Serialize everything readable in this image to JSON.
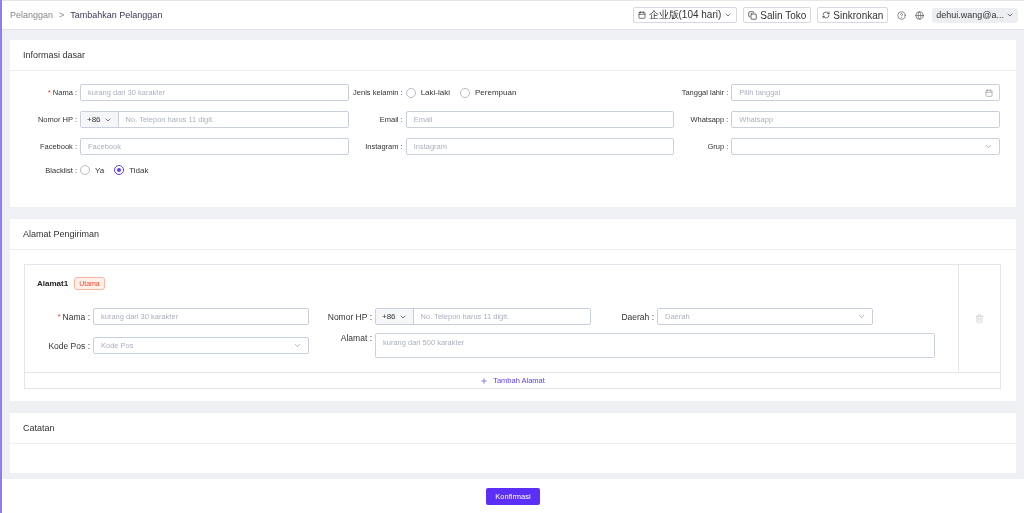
{
  "breadcrumb": {
    "parent": "Pelanggan",
    "separator": ">",
    "current": "Tambahkan Pelanggan"
  },
  "header": {
    "plan": "企业版(104 hari)",
    "buttons": [
      {
        "kind": "copy",
        "label": "Salin Toko"
      },
      {
        "kind": "sync",
        "label": "Sinkronkan"
      }
    ],
    "user": "dehui.wang@a..."
  },
  "basic_info": {
    "title": "Informasi dasar",
    "fields": [
      {
        "kind": "text",
        "required_mark": "*",
        "label": "Nama :",
        "placeholder": "kurang dari 30 karakter"
      },
      {
        "kind": "radio",
        "label": "Jenis kelamin :",
        "options": [
          {
            "label": "Laki-laki",
            "selected": false
          },
          {
            "label": "Perempuan",
            "selected": false
          }
        ]
      },
      {
        "kind": "date",
        "label": "Tanggal lahir :",
        "placeholder": "Pilih tanggal"
      },
      {
        "kind": "phone",
        "label": "Nomor HP :",
        "code": "+86",
        "placeholder": "No. Telepon harus 11 digit."
      },
      {
        "kind": "text",
        "label": "Email :",
        "placeholder": "Email"
      },
      {
        "kind": "text",
        "label": "Whatsapp :",
        "placeholder": "Whatsapp"
      },
      {
        "kind": "text",
        "label": "Facebook :",
        "placeholder": "Facebook"
      },
      {
        "kind": "text",
        "label": "Instagram :",
        "placeholder": "Instagram"
      },
      {
        "kind": "select",
        "label": "Grup :"
      },
      {
        "kind": "radio",
        "label": "Blacklist :",
        "options": [
          {
            "label": "Ya",
            "selected": false
          },
          {
            "label": "Tidak",
            "selected": true
          }
        ]
      }
    ]
  },
  "shipping": {
    "title": "Alamat Pengiriman",
    "addresses": [
      {
        "title": "Alamat1",
        "badge": "Utama",
        "fields": [
          {
            "kind": "text",
            "required_mark": "*",
            "label": "Nama :",
            "placeholder": "kurang dari 30 karakter"
          },
          {
            "kind": "phone",
            "label": "Nomor HP :",
            "code": "+86",
            "placeholder": "No. Telepon harus 11 digit."
          },
          {
            "kind": "select",
            "label": "Daerah :",
            "placeholder": "Daerah"
          },
          {
            "kind": "select",
            "label": "Kode Pos :",
            "placeholder": "Kode Pos"
          },
          {
            "kind": "textarea",
            "label": "Alamat :",
            "placeholder": "kurang dari 500 karakter"
          }
        ]
      }
    ],
    "add_label": "Tambah Alamat"
  },
  "notes": {
    "title": "Catatan"
  },
  "confirm": "Konfirmasi"
}
